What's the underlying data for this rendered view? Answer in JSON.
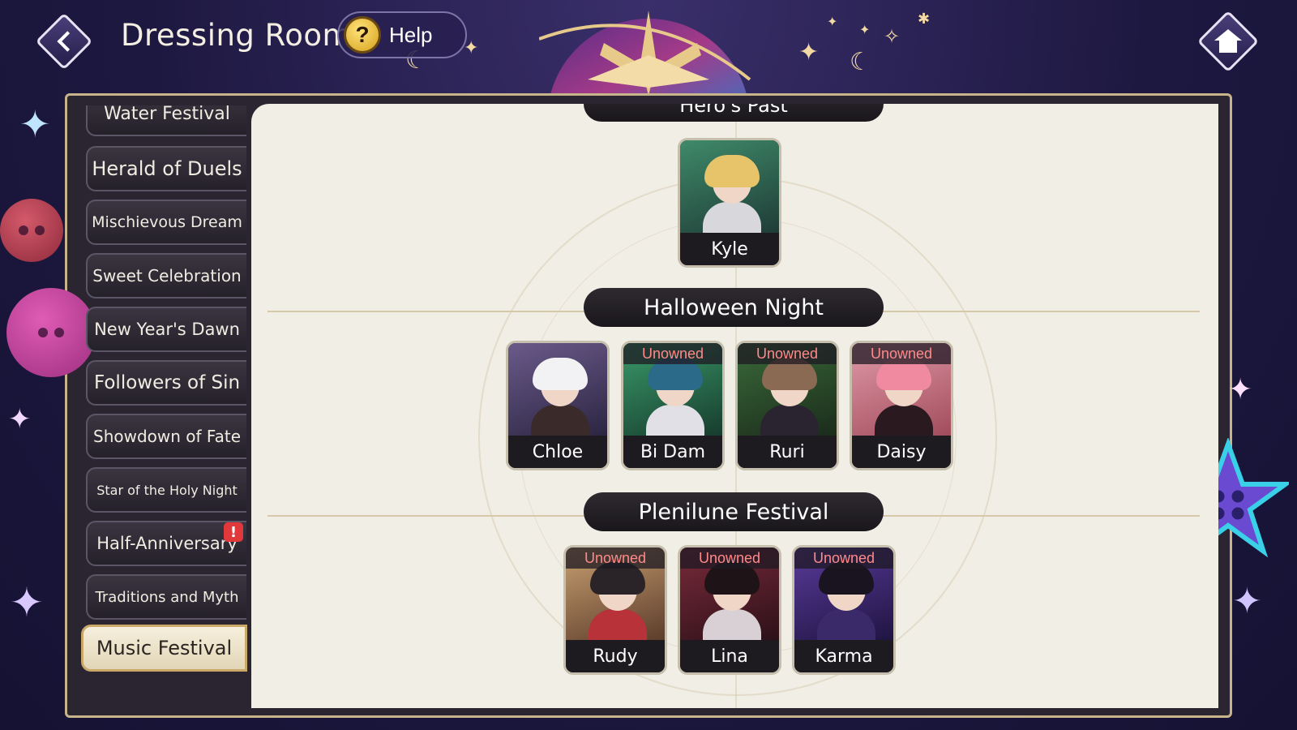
{
  "header": {
    "title": "Dressing Room",
    "help_label": "Help",
    "help_icon": "question-icon",
    "back_icon": "back-diamond-icon",
    "home_icon": "home-icon"
  },
  "sidebar": {
    "items": [
      {
        "label": "Water Festival",
        "partial": true
      },
      {
        "label": "Herald of Duels"
      },
      {
        "label": "Mischievous Dream"
      },
      {
        "label": "Sweet Celebration"
      },
      {
        "label": "New Year's Dawn"
      },
      {
        "label": "Followers of Sin"
      },
      {
        "label": "Showdown of Fate"
      },
      {
        "label": "Star of the Holy Night"
      },
      {
        "label": "Half-Anniversary",
        "alert": "!"
      },
      {
        "label": "Traditions and Myth"
      },
      {
        "label": "Music Festival",
        "selected": true
      }
    ]
  },
  "sections": [
    {
      "title": "Hero's Past",
      "partial": true,
      "characters": [
        {
          "name": "Kyle",
          "unowned": false
        }
      ]
    },
    {
      "title": "Halloween Night",
      "characters": [
        {
          "name": "Chloe",
          "unowned": false
        },
        {
          "name": "Bi Dam",
          "unowned": true
        },
        {
          "name": "Ruri",
          "unowned": true
        },
        {
          "name": "Daisy",
          "unowned": true
        }
      ]
    },
    {
      "title": "Plenilune Festival",
      "characters": [
        {
          "name": "Rudy",
          "unowned": true
        },
        {
          "name": "Lina",
          "unowned": true
        },
        {
          "name": "Karma",
          "unowned": true
        }
      ]
    }
  ],
  "status_text": {
    "unowned": "Unowned"
  },
  "colors": {
    "background": "#1d1840",
    "panel": "#f1eee6",
    "banner": "#1a171c",
    "unowned_text": "#ff8a8a",
    "selected_tab": "#f6efdc",
    "alert_badge": "#e0383b",
    "accent_gold": "#c9a868"
  }
}
